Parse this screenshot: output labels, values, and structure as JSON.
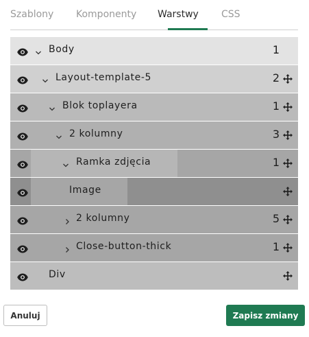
{
  "tabs": [
    {
      "label": "Szablony",
      "active": false
    },
    {
      "label": "Komponenty",
      "active": false
    },
    {
      "label": "Warstwy",
      "active": true
    },
    {
      "label": "CSS",
      "active": false
    }
  ],
  "layers": [
    {
      "label": "Body",
      "depth": 0,
      "caret": "down",
      "count": "1",
      "movable": false,
      "visible_icon": "eye-icon"
    },
    {
      "label": "Layout-template-5",
      "depth": 1,
      "caret": "down",
      "count": "2",
      "movable": true,
      "visible_icon": "eye-icon"
    },
    {
      "label": "Blok toplayera",
      "depth": 2,
      "caret": "down",
      "count": "1",
      "movable": true,
      "visible_icon": "eye-icon"
    },
    {
      "label": "2 kolumny",
      "depth": 3,
      "caret": "down",
      "count": "3",
      "movable": true,
      "visible_icon": "eye-icon"
    },
    {
      "label": "Ramka zdjęcia",
      "depth": 4,
      "caret": "down",
      "count": "1",
      "movable": true,
      "visible_icon": "eye-icon"
    },
    {
      "label": "Image",
      "depth": 4,
      "caret": "none",
      "count": "",
      "movable": true,
      "visible_icon": "eye-icon"
    },
    {
      "label": "2 kolumny",
      "depth": 4,
      "caret": "right",
      "count": "5",
      "movable": true,
      "visible_icon": "eye-icon"
    },
    {
      "label": "Close-button-thick",
      "depth": 4,
      "caret": "right",
      "count": "1",
      "movable": true,
      "visible_icon": "eye-icon"
    },
    {
      "label": "Div",
      "depth": 0,
      "caret": "none",
      "count": "",
      "movable": true,
      "visible_icon": "eye-icon"
    }
  ],
  "buttons": {
    "cancel_label": "Anuluj",
    "save_label": "Zapisz zmiany"
  },
  "colors": {
    "accent": "#1f7a52",
    "row_body": "#e3e3e3",
    "row_selected": "#8f8f8f"
  }
}
